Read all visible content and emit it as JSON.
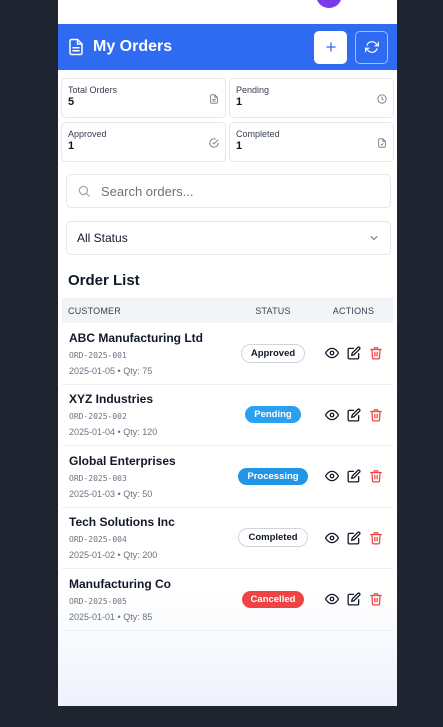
{
  "header": {
    "title": "My Orders"
  },
  "stats": [
    {
      "label": "Total Orders",
      "value": "5",
      "icon": "file-icon"
    },
    {
      "label": "Pending",
      "value": "1",
      "icon": "clock-icon"
    },
    {
      "label": "Approved",
      "value": "1",
      "icon": "check-circle-icon"
    },
    {
      "label": "Completed",
      "value": "1",
      "icon": "file-check-icon"
    }
  ],
  "search": {
    "placeholder": "Search orders..."
  },
  "filter": {
    "selected": "All Status"
  },
  "list": {
    "title": "Order List",
    "columns": [
      "CUSTOMER",
      "STATUS",
      "ACTIONS"
    ],
    "rows": [
      {
        "customer": "ABC Manufacturing Ltd",
        "code": "ORD-2025-001",
        "meta": "2025-01-05 • Qty: 75",
        "status": "Approved"
      },
      {
        "customer": "XYZ Industries",
        "code": "ORD-2025-002",
        "meta": "2025-01-04 • Qty: 120",
        "status": "Pending"
      },
      {
        "customer": "Global Enterprises",
        "code": "ORD-2025-003",
        "meta": "2025-01-03 • Qty: 50",
        "status": "Processing"
      },
      {
        "customer": "Tech Solutions Inc",
        "code": "ORD-2025-004",
        "meta": "2025-01-02 • Qty: 200",
        "status": "Completed"
      },
      {
        "customer": "Manufacturing Co",
        "code": "ORD-2025-005",
        "meta": "2025-01-01 • Qty: 85",
        "status": "Cancelled"
      }
    ]
  },
  "colors": {
    "header": "#2f6bf1",
    "pending": "#2aa0f0",
    "processing": "#2196e8",
    "cancelled": "#ef4444",
    "delete": "#ef4444"
  }
}
